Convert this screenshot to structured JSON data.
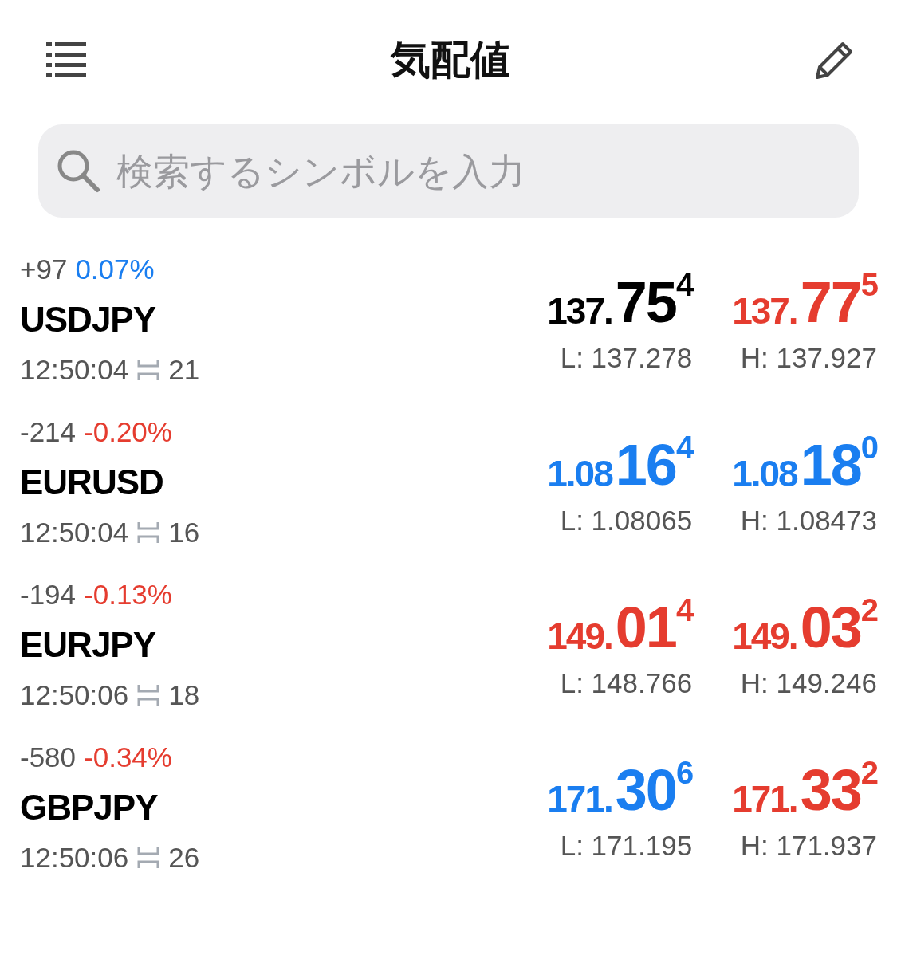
{
  "header": {
    "title": "気配値"
  },
  "search": {
    "placeholder": "検索するシンボルを入力"
  },
  "quotes": [
    {
      "change": "+97",
      "percent": {
        "text": "0.07%",
        "color": "#1a7ef0"
      },
      "symbol": "USDJPY",
      "time": "12:50:04",
      "spread": "21",
      "bid": {
        "prefix": "137.",
        "big": "75",
        "sup": "4",
        "color": "#000000"
      },
      "ask": {
        "prefix": "137.",
        "big": "77",
        "sup": "5",
        "color": "#e53c2f"
      },
      "low": "L: 137.278",
      "high": "H: 137.927"
    },
    {
      "change": "-214",
      "percent": {
        "text": "-0.20%",
        "color": "#e53c2f"
      },
      "symbol": "EURUSD",
      "time": "12:50:04",
      "spread": "16",
      "bid": {
        "prefix": "1.08",
        "big": "16",
        "sup": "4",
        "color": "#1a7ef0"
      },
      "ask": {
        "prefix": "1.08",
        "big": "18",
        "sup": "0",
        "color": "#1a7ef0"
      },
      "low": "L: 1.08065",
      "high": "H: 1.08473"
    },
    {
      "change": "-194",
      "percent": {
        "text": "-0.13%",
        "color": "#e53c2f"
      },
      "symbol": "EURJPY",
      "time": "12:50:06",
      "spread": "18",
      "bid": {
        "prefix": "149.",
        "big": "01",
        "sup": "4",
        "color": "#e53c2f"
      },
      "ask": {
        "prefix": "149.",
        "big": "03",
        "sup": "2",
        "color": "#e53c2f"
      },
      "low": "L: 148.766",
      "high": "H: 149.246"
    },
    {
      "change": "-580",
      "percent": {
        "text": "-0.34%",
        "color": "#e53c2f"
      },
      "symbol": "GBPJPY",
      "time": "12:50:06",
      "spread": "26",
      "bid": {
        "prefix": "171.",
        "big": "30",
        "sup": "6",
        "color": "#1a7ef0"
      },
      "ask": {
        "prefix": "171.",
        "big": "33",
        "sup": "2",
        "color": "#e53c2f"
      },
      "low": "L: 171.195",
      "high": "H: 171.937"
    }
  ]
}
